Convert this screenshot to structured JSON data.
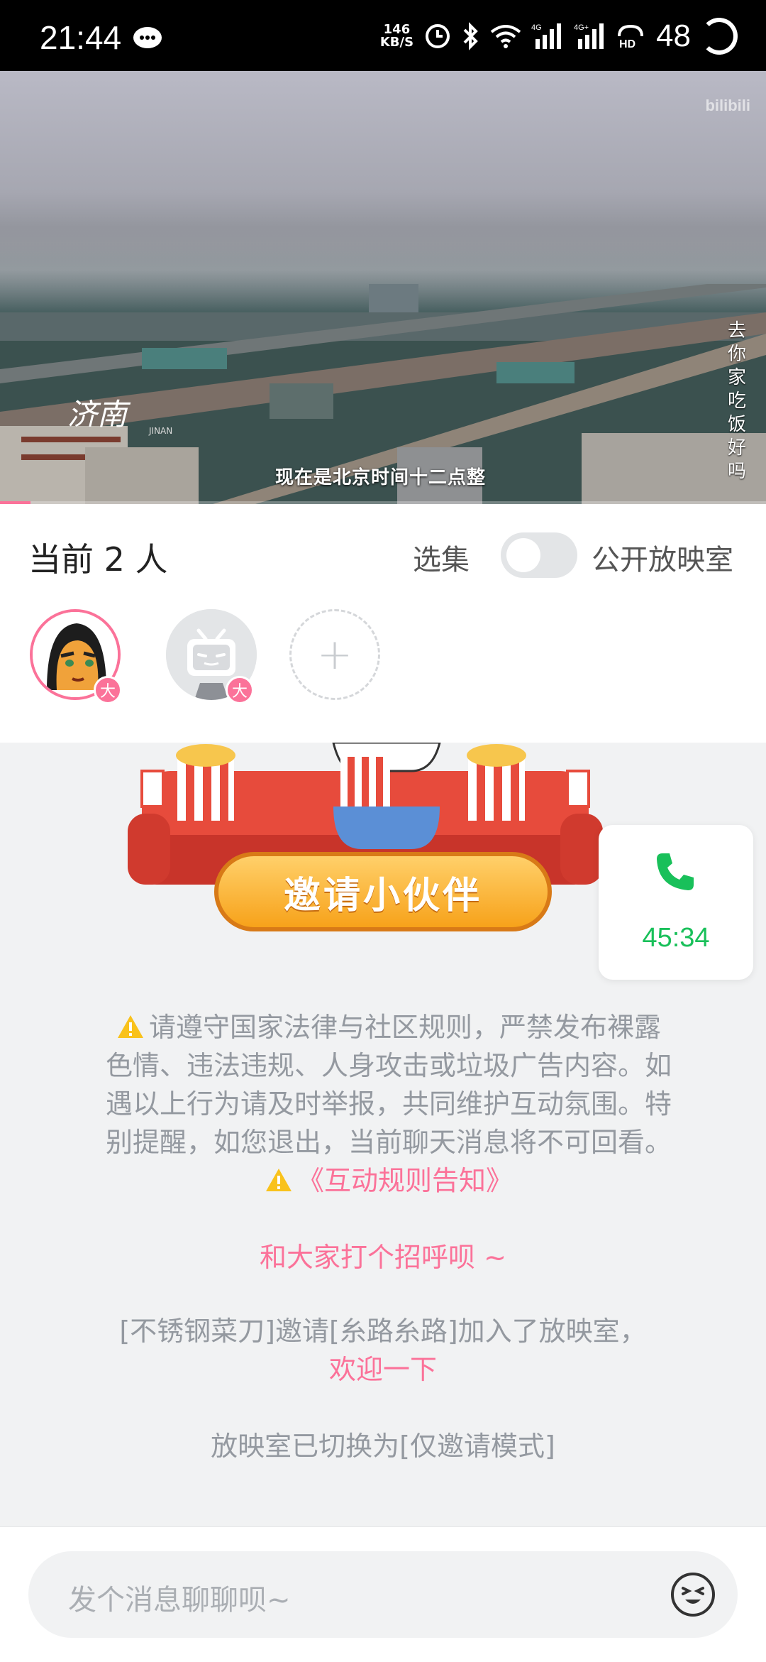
{
  "status_bar": {
    "time": "21:44",
    "net_speed_value": "146",
    "net_speed_unit": "KB/S",
    "net_label_1": "4G",
    "net_label_2": "4G+",
    "battery": "48",
    "icons": [
      "wechat-icon",
      "alarm-icon",
      "bluetooth-icon",
      "wifi-icon",
      "signal-icon",
      "signal-icon",
      "hd-call-icon",
      "battery-ring-icon"
    ]
  },
  "video": {
    "watermark": "bilibili",
    "city_name": "济南",
    "city_sub": "JINAN",
    "subtitle": "现在是北京时间十二点整",
    "vertical_text": "去你家吃饭好吗",
    "progress": 0.04
  },
  "room": {
    "count_label": "当前 2 人",
    "episode_label": "选集",
    "public_label": "公开放映室",
    "public_enabled": false,
    "members": [
      {
        "name": "不锈钢菜刀",
        "badge": "大"
      },
      {
        "name": "糸路糸路",
        "badge": "大"
      }
    ]
  },
  "banner": {
    "invite_button": "邀请小伙伴"
  },
  "call": {
    "duration": "45:34",
    "color": "#19c05a"
  },
  "chat": {
    "notice": "请遵守国家法律与社区规则，严禁发布裸露色情、违法违规、人身攻击或垃圾广告内容。如遇以上行为请及时举报，共同维护互动氛围。特别提醒，如您退出，当前聊天消息将不可回看。",
    "rules_link": "《互动规则告知》",
    "greeting": "和大家打个招呼呗 ~",
    "invite_message": "[不锈钢菜刀]邀请[糸路糸路]加入了放映室，",
    "welcome_link": "欢迎一下",
    "mode_message": "放映室已切换为[仅邀请模式]"
  },
  "input": {
    "placeholder": "发个消息聊聊呗~"
  },
  "colors": {
    "accent": "#fb7299",
    "muted_text": "#9499a0",
    "background": "#f1f2f3"
  }
}
